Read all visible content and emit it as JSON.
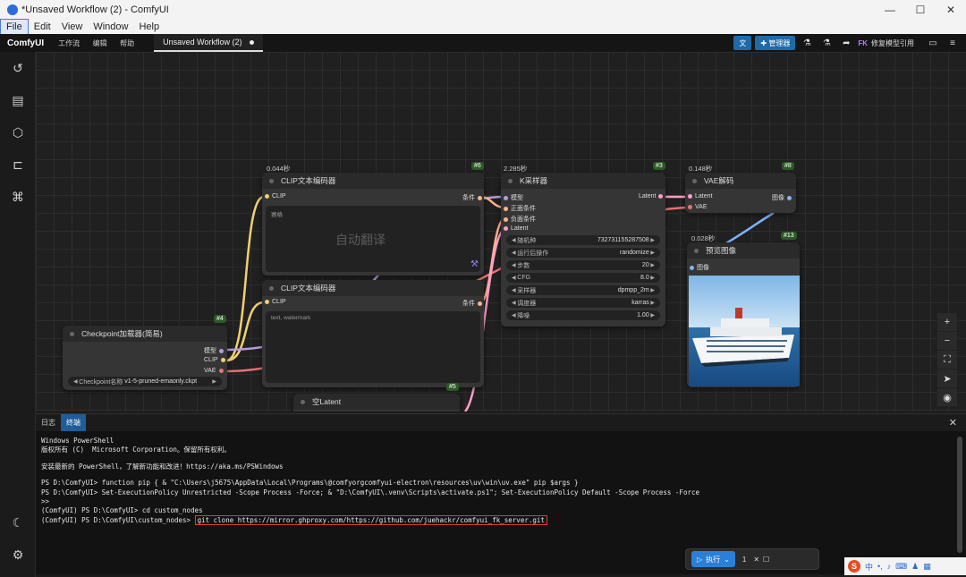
{
  "window": {
    "title": "*Unsaved Workflow (2) - ComfyUI",
    "controls": [
      "—",
      "☐",
      "✕"
    ]
  },
  "menubar": [
    "File",
    "Edit",
    "View",
    "Window",
    "Help"
  ],
  "appbar": {
    "brand": "ComfyUI",
    "menus": [
      "工作流",
      "编辑",
      "帮助"
    ],
    "tab_label": "Unsaved Workflow (2)",
    "manager_label": "管理器",
    "fk_badge": "FK",
    "fk_label": "修复模型引用",
    "translate_icon": "translate-icon",
    "accent": "#1f6aa8"
  },
  "nodes": {
    "clip1": {
      "timing": "0.044秒",
      "id": "#6",
      "title": "CLIP文本编码器",
      "in": "CLIP",
      "out": "条件",
      "text": "赛格",
      "ghost": "自动翻译"
    },
    "clip2": {
      "title": "CLIP文本编码器",
      "in": "CLIP",
      "out": "条件",
      "text": "text, watermark"
    },
    "ksampler": {
      "timing": "2.285秒",
      "id": "#3",
      "title": "K采样器",
      "inputs": [
        "模型",
        "正面条件",
        "负面条件",
        "Latent"
      ],
      "output": "Latent",
      "widgets": [
        {
          "label": "随机种",
          "value": "732731155287508"
        },
        {
          "label": "运行后操作",
          "value": "randomize"
        },
        {
          "label": "步数",
          "value": "20"
        },
        {
          "label": "CFG",
          "value": "8.0"
        },
        {
          "label": "采样器",
          "value": "dpmpp_2m"
        },
        {
          "label": "调度器",
          "value": "karras"
        },
        {
          "label": "降噪",
          "value": "1.00"
        }
      ]
    },
    "vae": {
      "timing": "0.148秒",
      "id": "#8",
      "title": "VAE解码",
      "inputs": [
        "Latent",
        "VAE"
      ],
      "output": "图像"
    },
    "preview": {
      "timing": "0.028秒",
      "id": "#13",
      "title": "预览图像",
      "input": "图像"
    },
    "checkpoint": {
      "id": "#4",
      "title": "Checkpoint加载器(简易)",
      "outputs": [
        "模型",
        "CLIP",
        "VAE"
      ],
      "widget_label": "Checkpoint名称",
      "widget_value": "v1-5-pruned-emaonly.ckpt"
    },
    "latent": {
      "id": "#5",
      "title": "空Latent"
    }
  },
  "panel": {
    "tabs": [
      "日志",
      "终端"
    ],
    "active_tab": "终端"
  },
  "terminal": {
    "lines": [
      "Windows PowerShell",
      "版权所有 (C)  Microsoft Corporation。保留所有权利。",
      "",
      "安装最新的 PowerShell，了解新功能和改进！https://aka.ms/PSWindows",
      "",
      "PS D:\\ComfyUI> function pip { & \"C:\\Users\\j5675\\AppData\\Local\\Programs\\@comfyorgcomfyui-electron\\resources\\uv\\win\\uv.exe\" pip $args }",
      "PS D:\\ComfyUI> Set-ExecutionPolicy Unrestricted -Scope Process -Force; & \"D:\\ComfyUI\\.venv\\Scripts\\activate.ps1\"; Set-ExecutionPolicy Default -Scope Process -Force",
      ">>",
      "(ComfyUI) PS D:\\ComfyUI> cd custom_nodes",
      "(ComfyUI) PS D:\\ComfyUI\\custom_nodes> "
    ],
    "highlighted_command": "git clone https://mirror.ghproxy.com/https://github.com/juehackr/comfyui_fk_server.git"
  },
  "runbar": {
    "run_label": "执行",
    "count": "1"
  },
  "ime": {
    "logo": "S",
    "lang": "中"
  }
}
